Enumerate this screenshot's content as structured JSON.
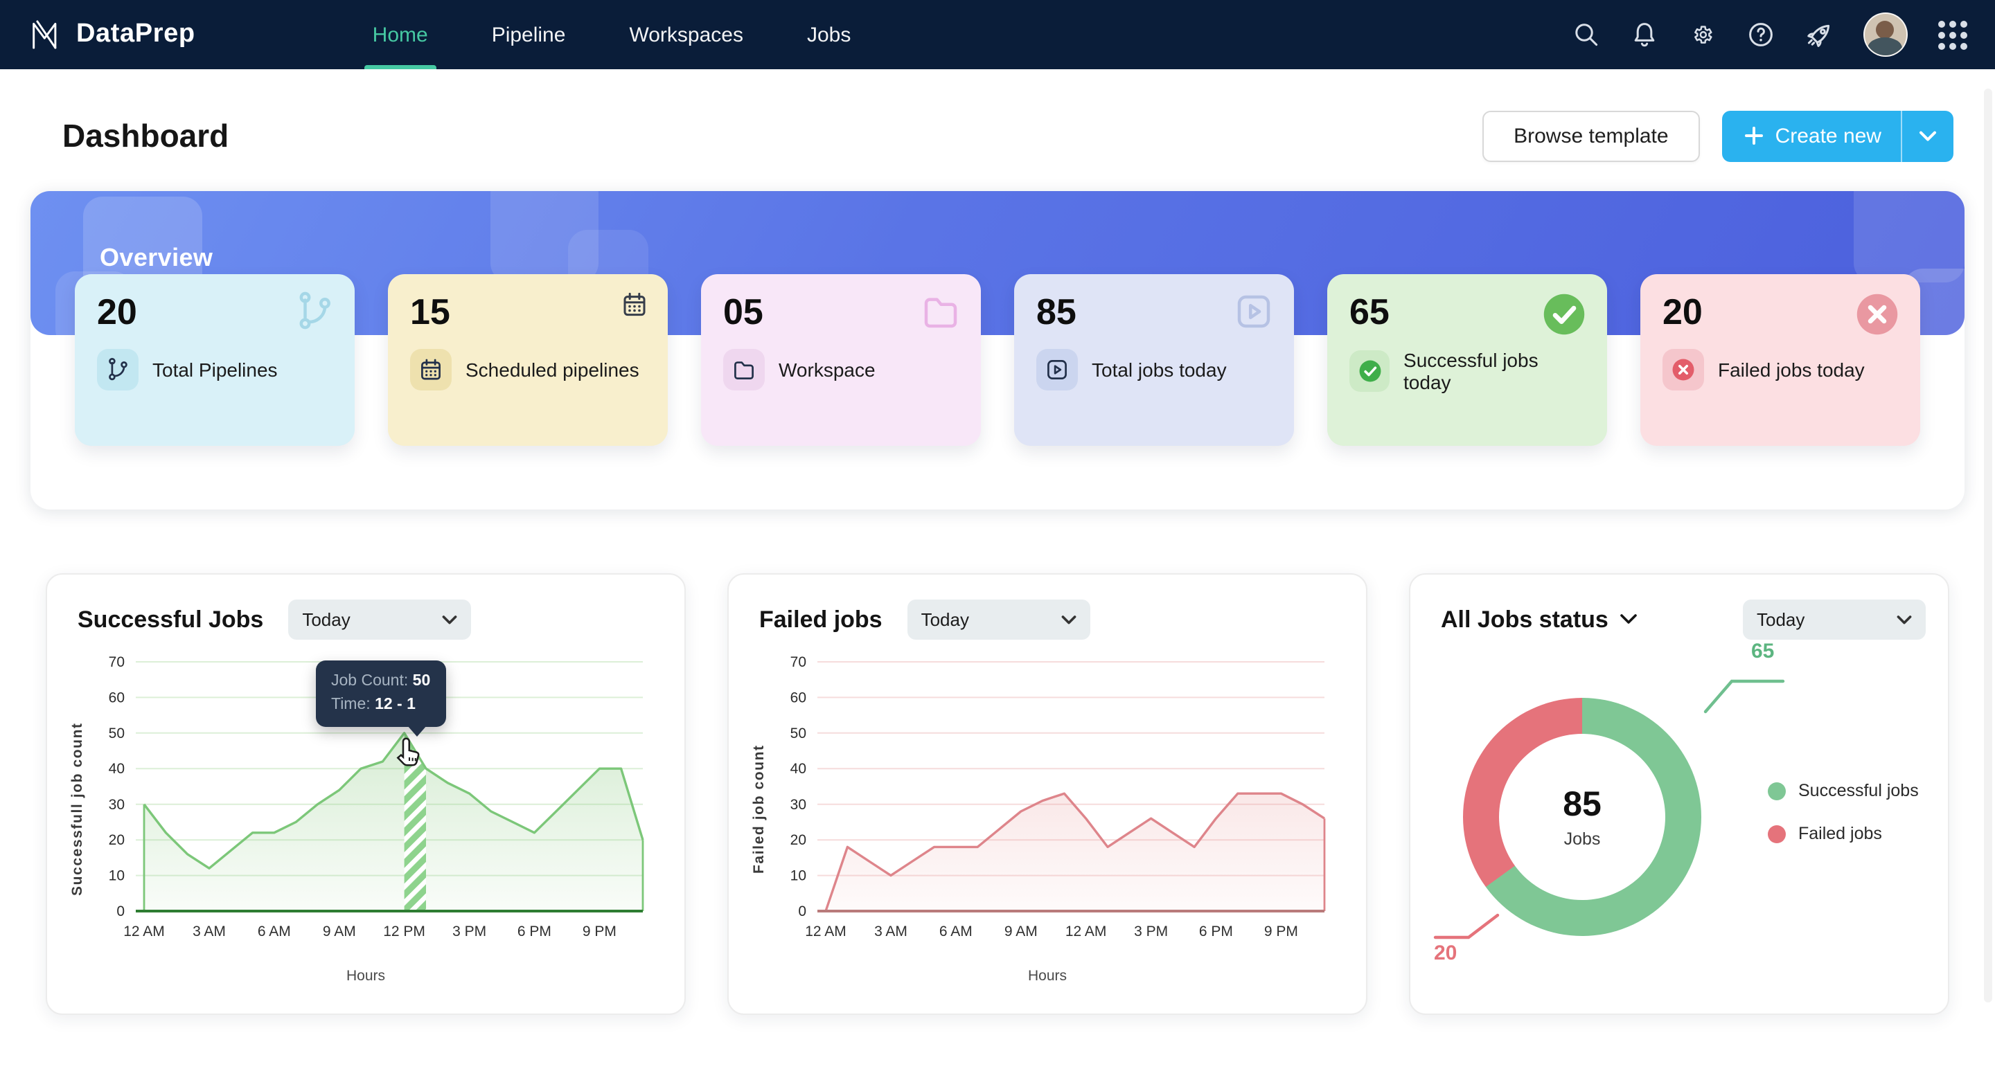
{
  "nav": {
    "brand": "DataPrep",
    "items": [
      {
        "label": "Home",
        "active": true
      },
      {
        "label": "Pipeline",
        "active": false
      },
      {
        "label": "Workspaces",
        "active": false
      },
      {
        "label": "Jobs",
        "active": false
      }
    ],
    "icons": [
      "search",
      "bell",
      "gear",
      "help",
      "rocket",
      "avatar",
      "apps-grid"
    ],
    "accent_color": "#46c9a3",
    "bg_color": "#0a1d39"
  },
  "header": {
    "title": "Dashboard",
    "browse_label": "Browse template",
    "create_label": "Create new"
  },
  "overview": {
    "title": "Overview",
    "cards": [
      {
        "value": "20",
        "label": "Total Pipelines",
        "icon": "git-branch",
        "bg": "#d9f1f8",
        "badge_bg": "#c2e7f1",
        "icon_color": "#22304a",
        "ghost_color": "#a3d6e7",
        "ghost_style": "outline",
        "ghost_size": 30
      },
      {
        "value": "15",
        "label": "Scheduled pipelines",
        "icon": "calendar",
        "bg": "#f8efcd",
        "badge_bg": "#eee1ae",
        "icon_color": "#22304a",
        "ghost_color": "#2c3444",
        "ghost_style": "outline",
        "ghost_size": 20
      },
      {
        "value": "05",
        "label": "Workspace",
        "icon": "folder",
        "bg": "#f8e7f8",
        "badge_bg": "#efd7ef",
        "icon_color": "#22304a",
        "ghost_color": "#e9b0e5",
        "ghost_style": "outline",
        "ghost_size": 30
      },
      {
        "value": "85",
        "label": "Total jobs today",
        "icon": "play-square",
        "bg": "#dfe4f6",
        "badge_bg": "#cbd5ef",
        "icon_color": "#22304a",
        "ghost_color": "#b4c1e4",
        "ghost_style": "outline",
        "ghost_size": 30
      },
      {
        "value": "65",
        "label": "Successful jobs today",
        "icon": "check-circle",
        "bg": "#def2d8",
        "badge_bg": "#cdeac6",
        "icon_color": "#3fae4a",
        "ghost_color": "#62bb55",
        "ghost_style": "filled",
        "ghost_size": 34
      },
      {
        "value": "20",
        "label": "Failed jobs today",
        "icon": "x-circle",
        "bg": "#fcdfe2",
        "badge_bg": "#f5c6cc",
        "icon_color": "#e35d6a",
        "ghost_color": "#e9959e",
        "ghost_style": "filled",
        "ghost_size": 34
      }
    ]
  },
  "charts": {
    "range_label": "Today"
  },
  "chart_data": [
    {
      "type": "area",
      "title": "Successful Jobs",
      "ylabel": "Successfull job count",
      "xlabel": "Hours",
      "ylim": [
        0,
        70
      ],
      "yticks": [
        0,
        10,
        20,
        30,
        40,
        50,
        60,
        70
      ],
      "tick_labels": [
        "12 AM",
        "3 AM",
        "6 AM",
        "9 AM",
        "12 PM",
        "3 PM",
        "6 PM",
        "9 PM"
      ],
      "values": [
        30,
        22,
        16,
        12,
        17,
        22,
        22,
        25,
        30,
        34,
        40,
        42,
        50,
        40,
        36,
        33,
        28,
        25,
        22,
        28,
        34,
        40,
        40,
        20
      ],
      "highlight_band": {
        "from_index": 12,
        "to_index": 13
      },
      "tooltip": {
        "count_label": "Job Count:",
        "count": 50,
        "time_label": "Time:",
        "time": "12 - 1"
      },
      "line_color": "#7cc779",
      "grid_color": "#dcefd7",
      "axis_color": "#2e7d32",
      "fill_from": "rgba(139,202,130,0.34)",
      "fill_to": "rgba(139,202,130,0.05)",
      "band_stripe": "#8ed38d"
    },
    {
      "type": "area",
      "title": "Failed jobs",
      "ylabel": "Failed job count",
      "xlabel": "Hours",
      "ylim": [
        0,
        70
      ],
      "yticks": [
        0,
        10,
        20,
        30,
        40,
        50,
        60,
        70
      ],
      "tick_labels": [
        "12 AM",
        "3 AM",
        "6 AM",
        "9 AM",
        "12 AM",
        "3 PM",
        "6 PM",
        "9 PM"
      ],
      "values": [
        0,
        18,
        14,
        10,
        14,
        18,
        18,
        18,
        23,
        28,
        31,
        33,
        26,
        18,
        22,
        26,
        22,
        18,
        26,
        33,
        33,
        33,
        30,
        26
      ],
      "line_color": "#de858b",
      "grid_color": "#f6dcdc",
      "axis_color": "#b97b7b",
      "fill_from": "rgba(231,150,150,0.22)",
      "fill_to": "rgba(231,150,150,0.04)"
    },
    {
      "type": "donut",
      "title": "All Jobs status",
      "total": 85,
      "total_label": "Jobs",
      "segments": [
        {
          "label": "Successful jobs",
          "value": 65,
          "color": "#7fc795",
          "sweep_deg": 234
        },
        {
          "label": "Failed jobs",
          "value": 20,
          "color": "#e5737b",
          "sweep_deg": 126
        }
      ],
      "legend_position": "right"
    }
  ]
}
